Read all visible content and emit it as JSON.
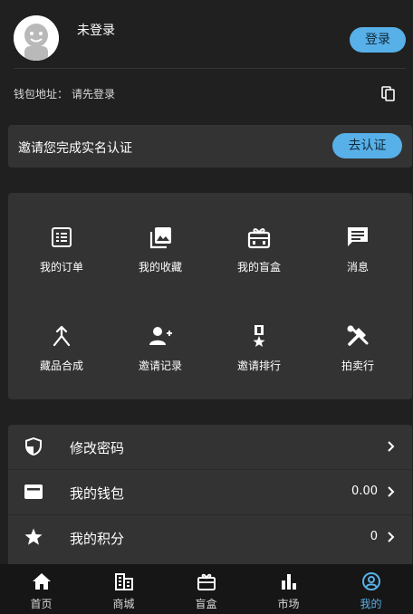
{
  "profile": {
    "username": "未登录",
    "login_label": "登录"
  },
  "wallet": {
    "label": "钱包地址：",
    "value": "请先登录"
  },
  "verify": {
    "text": "邀请您完成实名认证",
    "button": "去认证"
  },
  "grid": [
    {
      "label": "我的订单",
      "icon": "order-list-icon"
    },
    {
      "label": "我的收藏",
      "icon": "image-collection-icon"
    },
    {
      "label": "我的盲盒",
      "icon": "gift-box-icon"
    },
    {
      "label": "消息",
      "icon": "message-icon"
    },
    {
      "label": "藏品合成",
      "icon": "merge-icon"
    },
    {
      "label": "邀请记录",
      "icon": "person-add-icon"
    },
    {
      "label": "邀请排行",
      "icon": "medal-icon"
    },
    {
      "label": "拍卖行",
      "icon": "tools-icon"
    }
  ],
  "menu": [
    {
      "label": "修改密码",
      "value": "",
      "icon": "shield-icon"
    },
    {
      "label": "我的钱包",
      "value": "0.00",
      "icon": "wallet-icon"
    },
    {
      "label": "我的积分",
      "value": "0",
      "icon": "star-icon"
    }
  ],
  "tabs": [
    {
      "label": "首页",
      "icon": "home-icon"
    },
    {
      "label": "商城",
      "icon": "store-icon"
    },
    {
      "label": "盲盒",
      "icon": "gift-box-icon"
    },
    {
      "label": "市场",
      "icon": "bar-chart-icon"
    },
    {
      "label": "我的",
      "icon": "account-icon"
    }
  ],
  "colors": {
    "accent": "#58b0e8",
    "background": "#202020",
    "card": "#333333",
    "tabbar": "#161616"
  }
}
